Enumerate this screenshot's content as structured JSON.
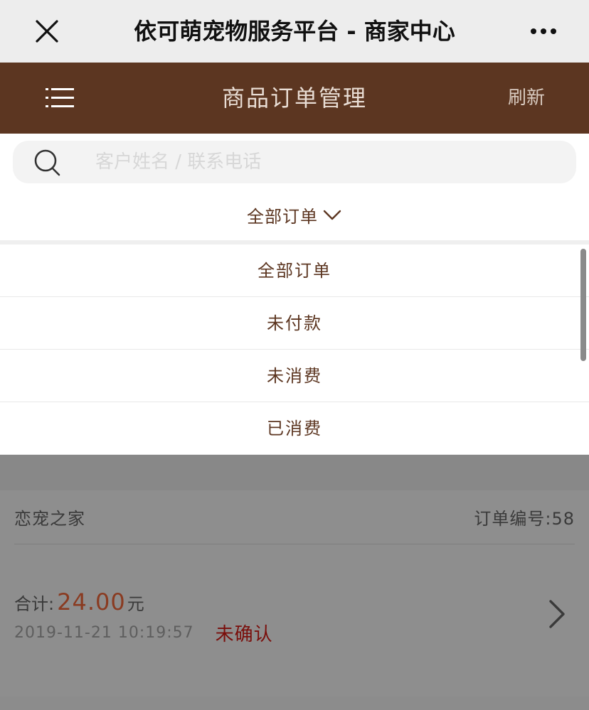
{
  "wechat": {
    "title": "依可萌宠物服务平台 - 商家中心",
    "icons": {
      "close": "close-icon",
      "more": "more-icon"
    }
  },
  "header": {
    "title": "商品订单管理",
    "refresh_label": "刷新",
    "menu_icon": "menu-icon",
    "background": "#5c3621"
  },
  "search": {
    "placeholder": "客户姓名 / 联系电话",
    "value": "",
    "icon": "search-icon"
  },
  "filter": {
    "selected": "全部订单",
    "options": [
      "全部订单",
      "未付款",
      "未消费",
      "已消费"
    ]
  },
  "orders": [
    {
      "shop_name": "恋宠之家",
      "order_no_label": "订单编号:",
      "order_no": "58",
      "total_label": "合计:",
      "amount": "24.00",
      "currency": "元",
      "time": "2019-11-21 10:19:57",
      "status": "未确认"
    }
  ],
  "colors": {
    "brand": "#5c3621",
    "amount": "#8a3b21",
    "status": "#7a0e0b",
    "overlay": "#8c8c8c"
  }
}
